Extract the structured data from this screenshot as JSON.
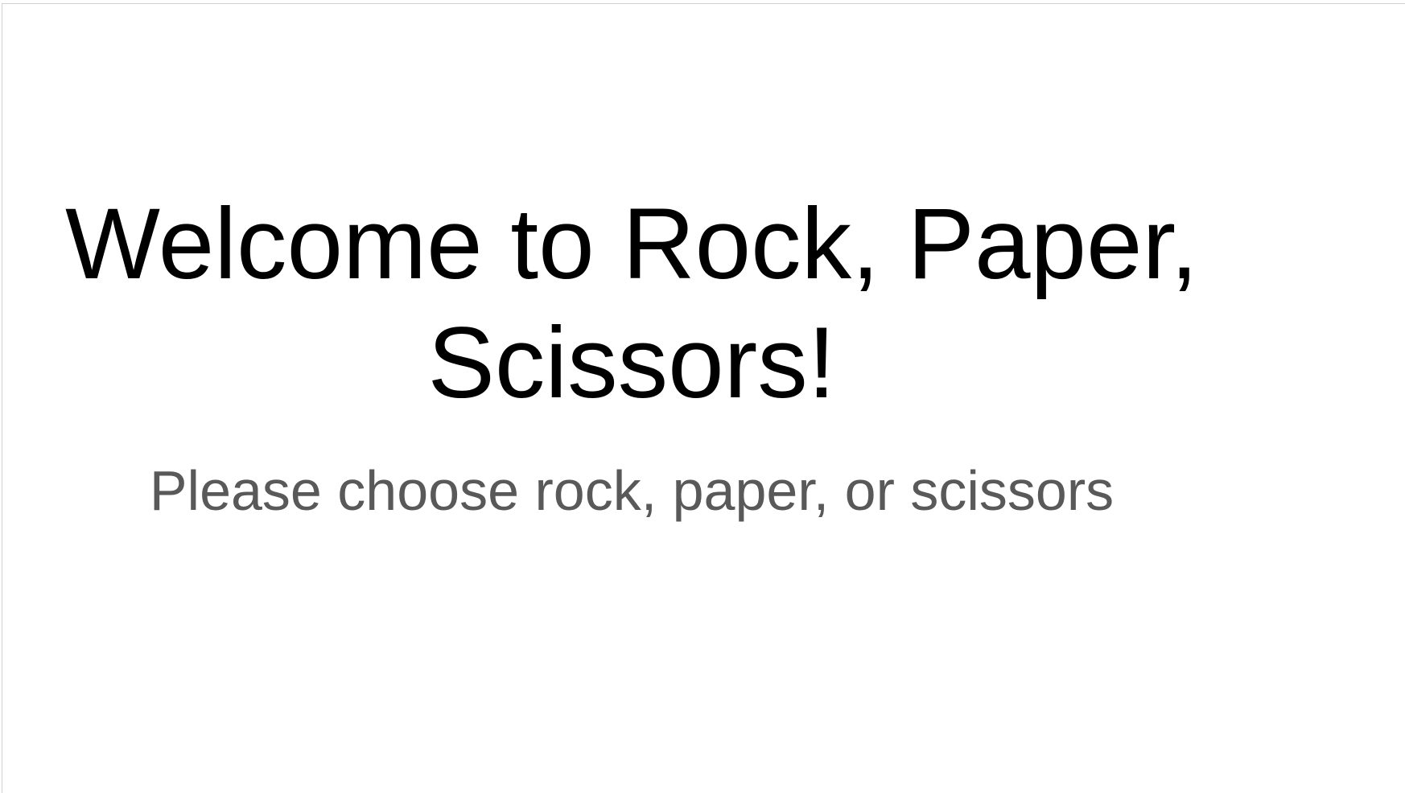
{
  "slide": {
    "title": "Welcome to Rock, Paper, Scissors!",
    "subtitle": "Please choose rock, paper, or scissors"
  },
  "colors": {
    "background": "#ffffff",
    "title": "#000000",
    "subtitle": "#595959"
  }
}
